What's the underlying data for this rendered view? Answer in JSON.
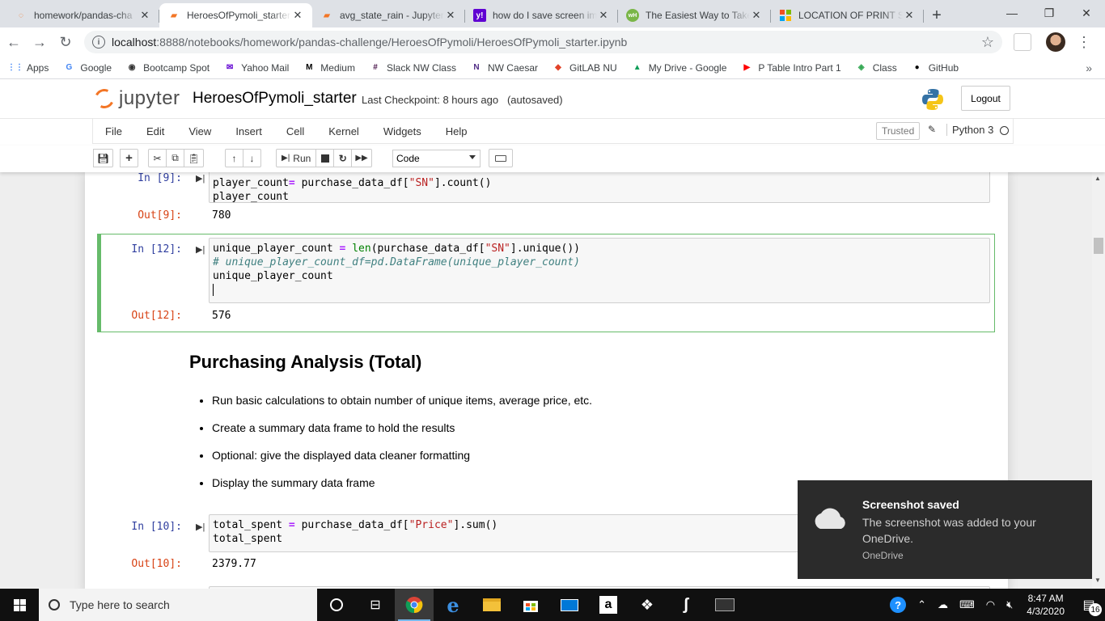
{
  "browser": {
    "tabs": [
      {
        "title": "homework/pandas-cha",
        "favicon": "jupyter-icon",
        "color": "#f37626"
      },
      {
        "title": "HeroesOfPymoli_starter",
        "favicon": "notebook-icon",
        "color": "#f37626"
      },
      {
        "title": "avg_state_rain - Jupyter",
        "favicon": "notebook-icon",
        "color": "#f37626"
      },
      {
        "title": "how do I save screen im",
        "favicon": "yahoo-icon",
        "color": "#6001d2"
      },
      {
        "title": "The Easiest Way to Take",
        "favicon": "wh-icon",
        "color": "#7ab648"
      },
      {
        "title": "LOCATION OF PRINT SC",
        "favicon": "windows-icon",
        "color": "#f25022"
      }
    ],
    "active_tab": 1,
    "url_host": "localhost",
    "url_path": ":8888/notebooks/homework/pandas-challenge/HeroesOfPymoli/HeroesOfPymoli_starter.ipynb",
    "bookmarks": [
      {
        "label": "Apps",
        "icon": "apps-grid-icon",
        "color": "#4285f4"
      },
      {
        "label": "Google",
        "icon": "google-icon",
        "color": "#4285f4"
      },
      {
        "label": "Bootcamp Spot",
        "icon": "bootcamp-icon",
        "color": "#333333"
      },
      {
        "label": "Yahoo Mail",
        "icon": "mail-icon",
        "color": "#6001d2"
      },
      {
        "label": "Medium",
        "icon": "medium-icon",
        "color": "#000000"
      },
      {
        "label": "Slack NW Class",
        "icon": "slack-icon",
        "color": "#4a154b"
      },
      {
        "label": "NW Caesar",
        "icon": "nw-icon",
        "color": "#4e2a84"
      },
      {
        "label": "GitLAB NU",
        "icon": "gitlab-icon",
        "color": "#e24329"
      },
      {
        "label": "My Drive - Google",
        "icon": "drive-icon",
        "color": "#0f9d58"
      },
      {
        "label": "P Table Intro Part 1",
        "icon": "youtube-icon",
        "color": "#ff0000"
      },
      {
        "label": "Class",
        "icon": "class-icon",
        "color": "#34a853"
      },
      {
        "label": "GitHub",
        "icon": "github-icon",
        "color": "#000000"
      }
    ]
  },
  "jupyter": {
    "logo_text": "jupyter",
    "notebook_name": "HeroesOfPymoli_starter",
    "checkpoint": "Last Checkpoint: 8 hours ago",
    "autosave": "(autosaved)",
    "logout_label": "Logout",
    "menu": [
      "File",
      "Edit",
      "View",
      "Insert",
      "Cell",
      "Kernel",
      "Widgets",
      "Help"
    ],
    "trusted_label": "Trusted",
    "kernel_name": "Python 3",
    "run_label": "Run",
    "cell_type": "Code",
    "accent": "#f37626"
  },
  "cells": {
    "c9": {
      "in_prompt": "In [9]:",
      "line1_var": "player_count",
      "line1_rest": " = purchase_data_df[",
      "line1_str": "\"SN\"",
      "line1_end": "].count()",
      "line2": "player_count",
      "out_prompt": "Out[9]:",
      "output": "780"
    },
    "c12": {
      "in_prompt": "In [12]:",
      "line1_a": "unique_player_count = ",
      "line1_fn": "len",
      "line1_b": "(purchase_data_df[",
      "line1_str": "\"SN\"",
      "line1_c": "].unique())",
      "line2_comment": "# unique_player_count_df=pd.DataFrame(unique_player_count)",
      "line3": "unique_player_count",
      "out_prompt": "Out[12]:",
      "output": "576"
    },
    "heading": "Purchasing Analysis (Total)",
    "bullets": [
      "Run basic calculations to obtain number of unique items, average price, etc.",
      "Create a summary data frame to hold the results",
      "Optional: give the displayed data cleaner formatting",
      "Display the summary data frame"
    ],
    "c10": {
      "in_prompt": "In [10]:",
      "line1_a": "total_spent = purchase_data_df[",
      "line1_str": "\"Price\"",
      "line1_b": "].sum()",
      "line2": "total_spent",
      "out_prompt": "Out[10]:",
      "output": "2379.77"
    }
  },
  "toast": {
    "title": "Screenshot saved",
    "body": "The screenshot was added to your OneDrive.",
    "source": "OneDrive"
  },
  "taskbar": {
    "search_placeholder": "Type here to search",
    "time": "8:47 AM",
    "date": "4/3/2020",
    "notification_count": "16"
  }
}
